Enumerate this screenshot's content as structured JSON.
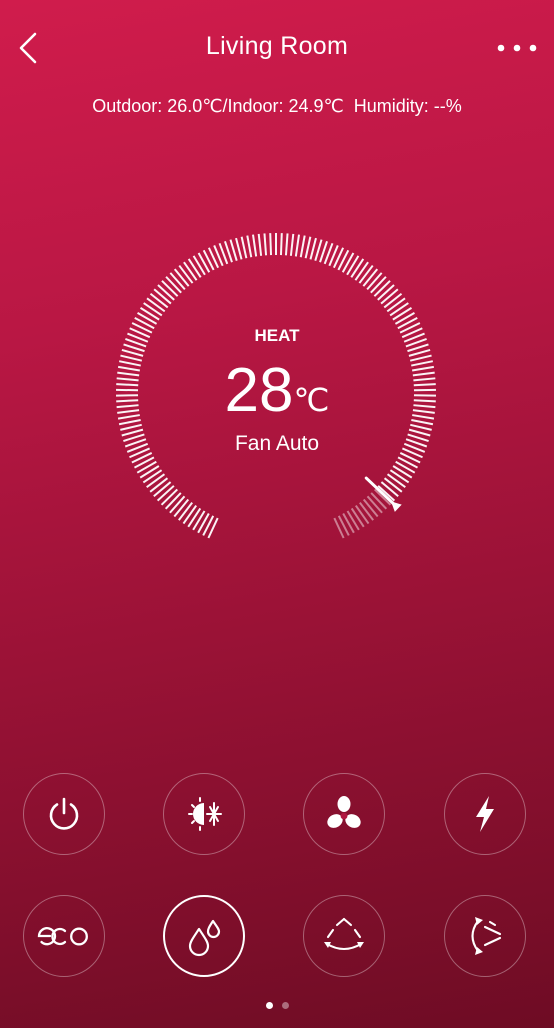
{
  "header": {
    "title": "Living Room",
    "back_icon": "chevron-left-icon",
    "more_icon": "more-horizontal-icon"
  },
  "status": {
    "outdoor": "Outdoor: 26.0℃/Indoor: 24.9℃",
    "humidity": "Humidity: --%"
  },
  "thermostat": {
    "mode": "HEAT",
    "temperature": "28",
    "unit": "℃",
    "fan": "Fan Auto",
    "setpoint_fraction": 0.93
  },
  "controls": [
    {
      "name": "power-button",
      "icon": "power-icon"
    },
    {
      "name": "mode-button",
      "icon": "sun-snowflake-icon"
    },
    {
      "name": "fan-speed-button",
      "icon": "fan-icon"
    },
    {
      "name": "turbo-button",
      "icon": "lightning-icon"
    },
    {
      "name": "eco-button",
      "icon": "eco-icon"
    },
    {
      "name": "dry-button",
      "icon": "water-drops-icon",
      "active": true
    },
    {
      "name": "swing-button",
      "icon": "swing-vertical-icon"
    },
    {
      "name": "swing-horizontal-button",
      "icon": "swing-horizontal-icon"
    }
  ],
  "pagination": {
    "pages": 2,
    "current": 1
  },
  "colors": {
    "accent": "#ffffff",
    "background_top": "#d01c4c",
    "background_bottom": "#6e0c24"
  }
}
